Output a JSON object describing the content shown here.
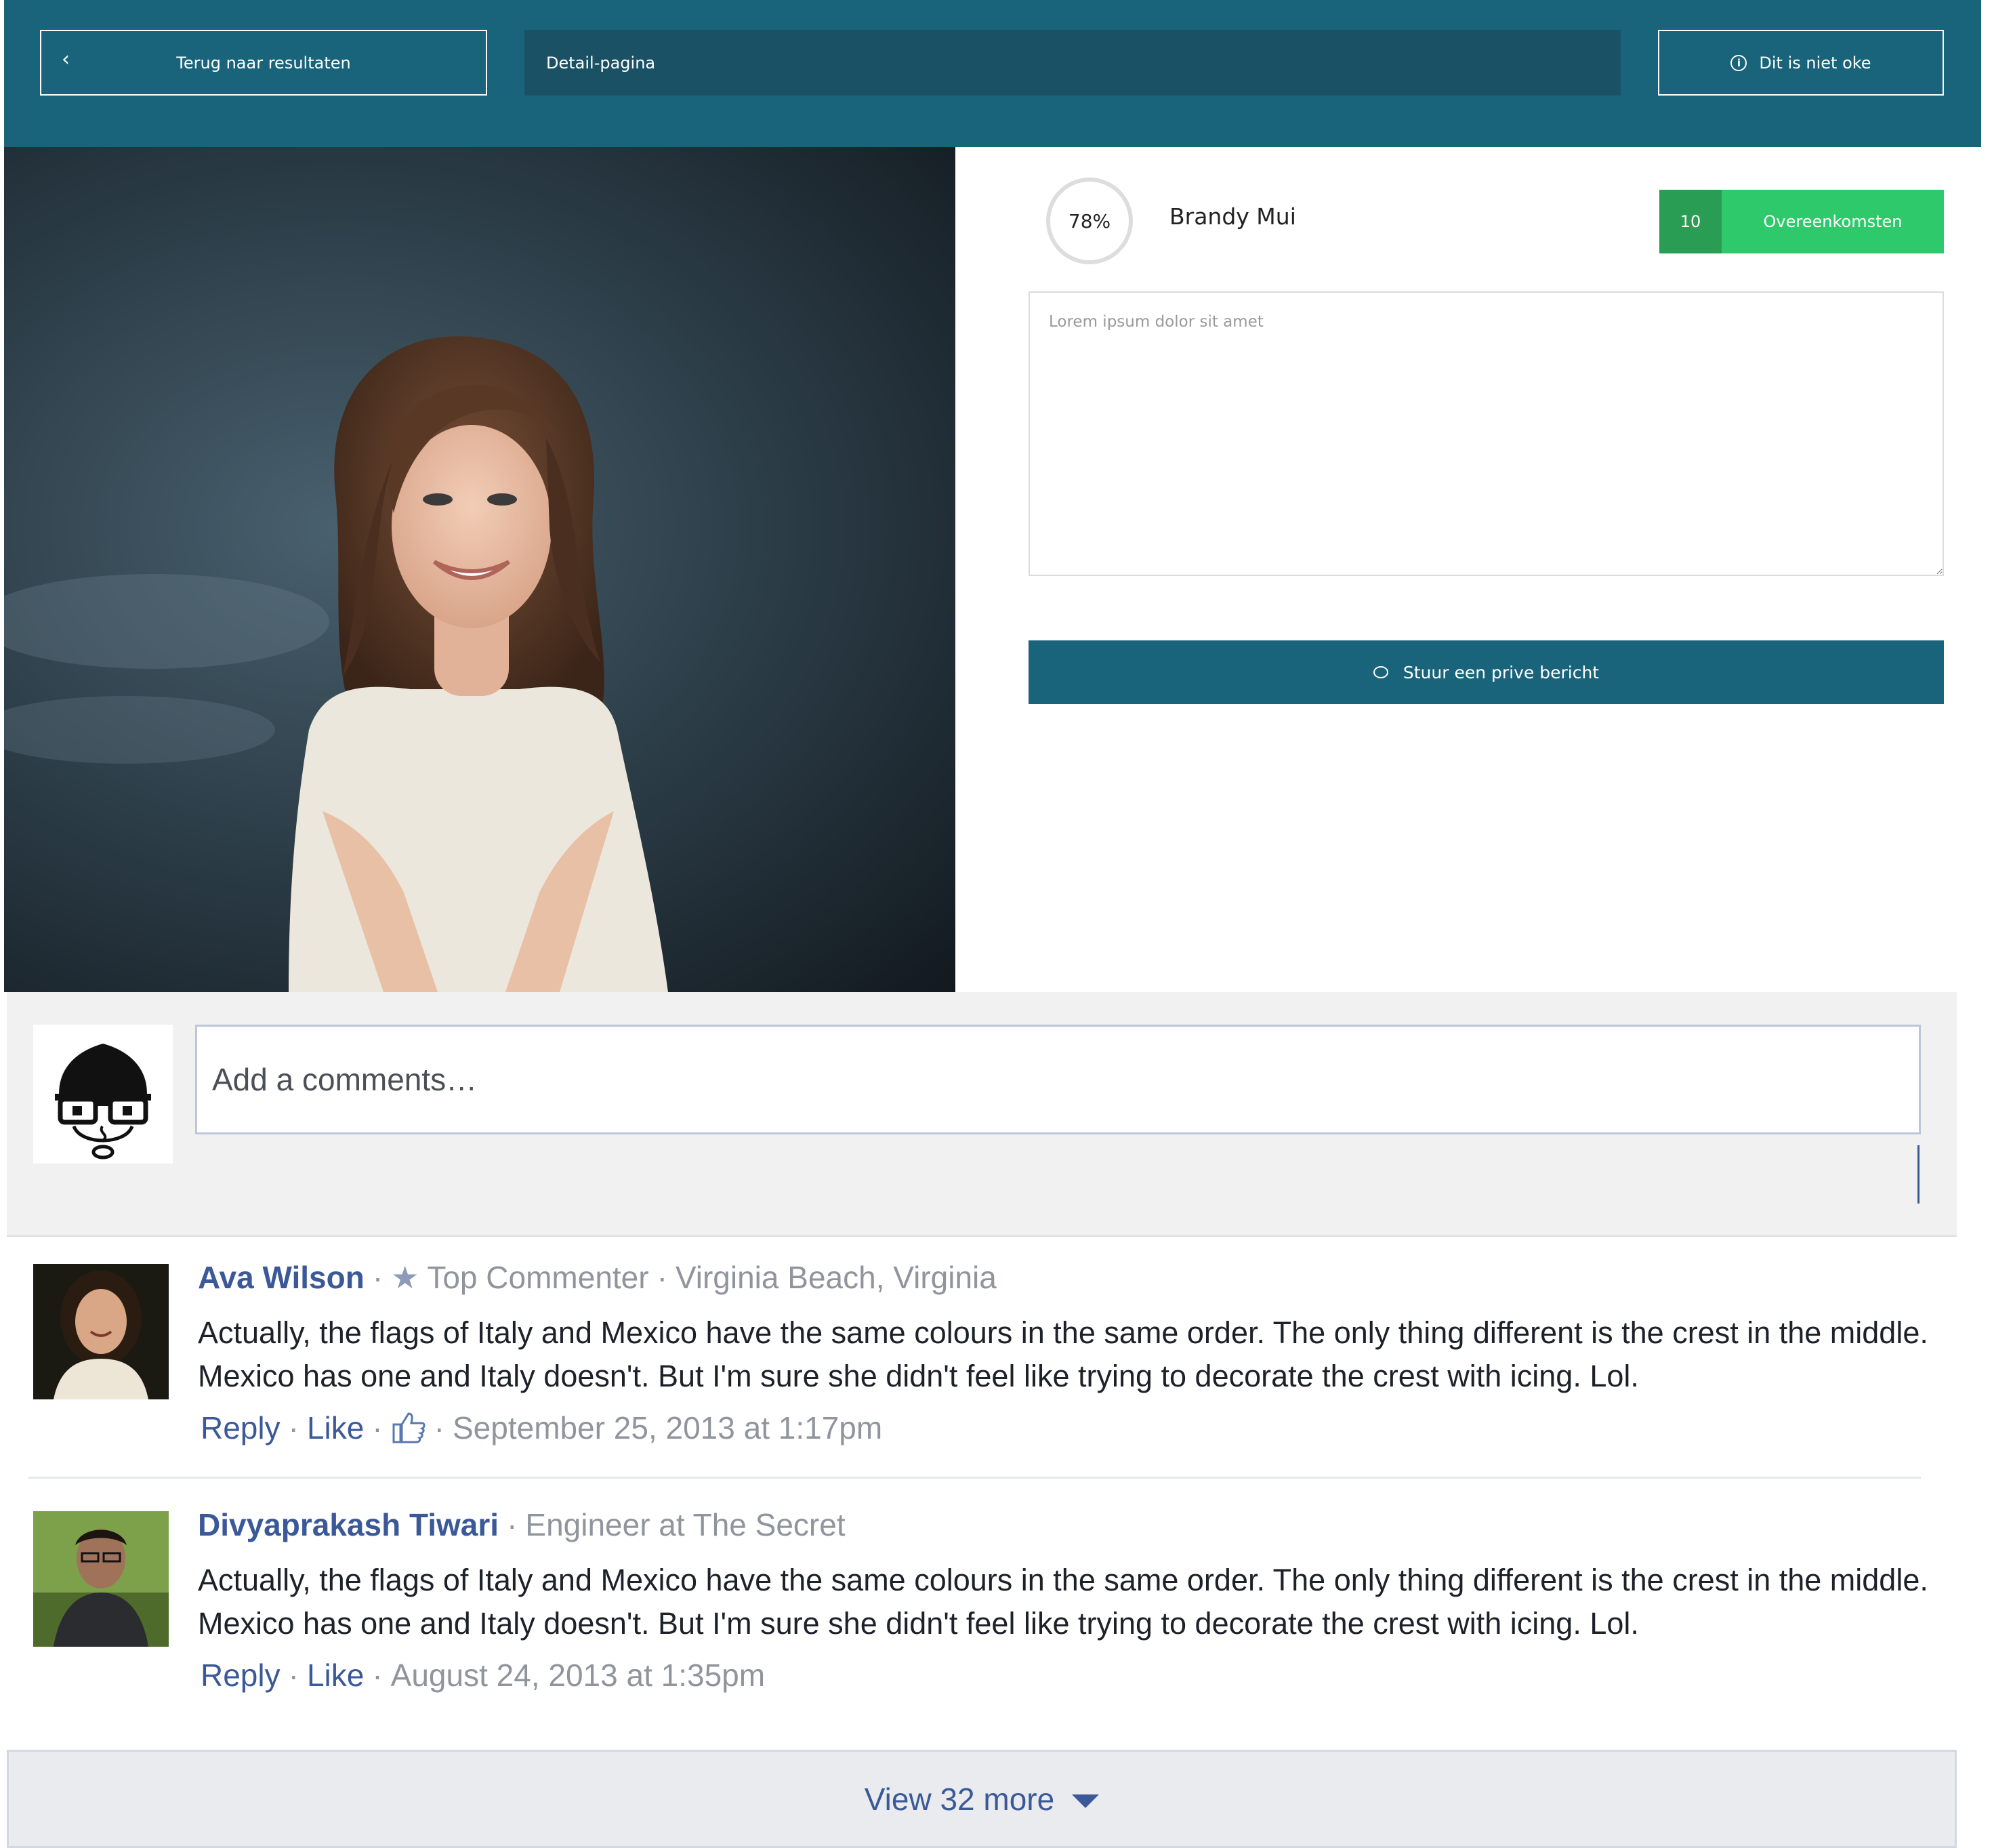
{
  "header": {
    "back_label": "Terug naar resultaten",
    "breadcrumb": "Detail-pagina",
    "report_label": "Dit is niet oke"
  },
  "profile": {
    "score": "78%",
    "score_value": 0.78,
    "name": "Brandy Mui",
    "match_count": "10",
    "match_label": "Overeenkomsten",
    "message_placeholder": "Lorem ipsum dolor sit amet",
    "send_label": "Stuur een prive bericht"
  },
  "composer": {
    "placeholder": "Add a comments…"
  },
  "comments": [
    {
      "author": "Ava Wilson",
      "badge": "Top Commenter",
      "location": "Virginia Beach, Virginia",
      "text": "Actually, the flags of Italy and Mexico have the same colours in the same order. The only thing different is the crest in the middle. Mexico has one and Italy doesn't. But I'm sure she didn't feel like trying to decorate the crest with icing. Lol.",
      "reply": "Reply",
      "like": "Like",
      "timestamp": "September 25, 2013 at 1:17pm"
    },
    {
      "author": "Divyaprakash Tiwari",
      "subtitle": "Engineer at The Secret",
      "text": "Actually, the flags of Italy and Mexico have the same colours in the same order. The only thing different is the crest in the middle. Mexico has one and Italy doesn't. But I'm sure she didn't feel like trying to decorate the crest with icing. Lol.",
      "reply": "Reply",
      "like": "Like",
      "timestamp": "August 24, 2013 at 1:35pm"
    }
  ],
  "view_more": "View 32 more",
  "colors": {
    "header": "#19647a",
    "breadcrumb": "#1b5165",
    "match_count": "#2a9d55",
    "match_button": "#2ec96a",
    "link": "#3b5998"
  },
  "icons": {
    "back": "chevron-left-icon",
    "report": "info-icon",
    "send": "speech-bubble-icon",
    "badge": "star-icon",
    "like": "thumbs-up-icon",
    "more": "caret-down-icon"
  }
}
